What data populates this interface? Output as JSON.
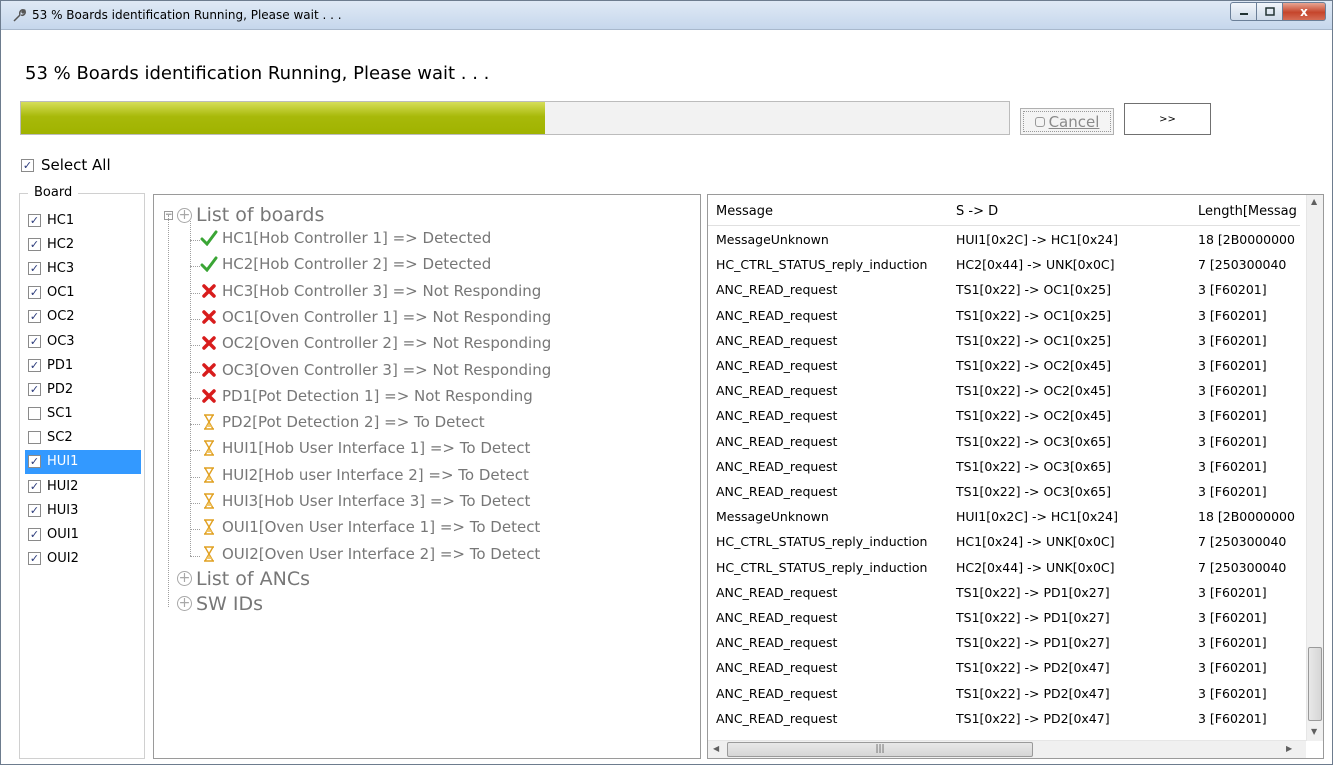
{
  "window": {
    "title": "53 % Boards identification Running, Please wait . . .",
    "close_label": "x"
  },
  "status": {
    "heading": "53 % Boards identification Running, Please wait . . .",
    "progress_percent": 53
  },
  "buttons": {
    "cancel": "Cancel",
    "more": ">>"
  },
  "select_all": {
    "label": "Select All",
    "checked": true
  },
  "board_group": {
    "legend": "Board",
    "items": [
      {
        "label": "HC1",
        "checked": true
      },
      {
        "label": "HC2",
        "checked": true
      },
      {
        "label": "HC3",
        "checked": true
      },
      {
        "label": "OC1",
        "checked": true
      },
      {
        "label": "OC2",
        "checked": true
      },
      {
        "label": "OC3",
        "checked": true
      },
      {
        "label": "PD1",
        "checked": true
      },
      {
        "label": "PD2",
        "checked": true
      },
      {
        "label": "SC1",
        "checked": false
      },
      {
        "label": "SC2",
        "checked": false
      },
      {
        "label": "HUI1",
        "checked": true,
        "selected": true
      },
      {
        "label": "HUI2",
        "checked": true
      },
      {
        "label": "HUI3",
        "checked": true
      },
      {
        "label": "OUI1",
        "checked": true
      },
      {
        "label": "OUI2",
        "checked": true
      }
    ]
  },
  "tree": {
    "roots": [
      {
        "label": "List of boards",
        "expanded": true,
        "children": [
          {
            "text": "HC1[Hob Controller 1] => Detected",
            "icon": "check-icon"
          },
          {
            "text": "HC2[Hob Controller 2] => Detected",
            "icon": "check-icon"
          },
          {
            "text": "HC3[Hob Controller 3] => Not Responding",
            "icon": "cross-icon"
          },
          {
            "text": "OC1[Oven Controller 1] => Not Responding",
            "icon": "cross-icon"
          },
          {
            "text": "OC2[Oven Controller 2] => Not Responding",
            "icon": "cross-icon"
          },
          {
            "text": "OC3[Oven Controller 3] => Not Responding",
            "icon": "cross-icon"
          },
          {
            "text": "PD1[Pot Detection 1] => Not Responding",
            "icon": "cross-icon"
          },
          {
            "text": "PD2[Pot Detection 2] => To Detect",
            "icon": "hourglass-icon"
          },
          {
            "text": "HUI1[Hob User Interface 1] => To Detect",
            "icon": "hourglass-icon"
          },
          {
            "text": "HUI2[Hob user Interface 2] => To Detect",
            "icon": "hourglass-icon"
          },
          {
            "text": "HUI3[Hob User Interface 3] => To Detect",
            "icon": "hourglass-icon"
          },
          {
            "text": "OUI1[Oven User Interface 1] => To Detect",
            "icon": "hourglass-icon"
          },
          {
            "text": "OUI2[Oven User Interface 2] => To Detect",
            "icon": "hourglass-icon"
          }
        ]
      },
      {
        "label": "List of ANCs",
        "expanded": false,
        "children": []
      },
      {
        "label": "SW IDs",
        "expanded": false,
        "children": []
      }
    ]
  },
  "messages": {
    "columns": [
      "Message",
      "S  -> D",
      "Length[Messag"
    ],
    "rows": [
      [
        "MessageUnknown",
        "HUI1[0x2C] -> HC1[0x24]",
        "18 [2B0000000"
      ],
      [
        "HC_CTRL_STATUS_reply_induction",
        "HC2[0x44] -> UNK[0x0C]",
        "7 [250300040"
      ],
      [
        "ANC_READ_request",
        "TS1[0x22] -> OC1[0x25]",
        "3 [F60201]"
      ],
      [
        "ANC_READ_request",
        "TS1[0x22] -> OC1[0x25]",
        "3 [F60201]"
      ],
      [
        "ANC_READ_request",
        "TS1[0x22] -> OC1[0x25]",
        "3 [F60201]"
      ],
      [
        "ANC_READ_request",
        "TS1[0x22] -> OC2[0x45]",
        "3 [F60201]"
      ],
      [
        "ANC_READ_request",
        "TS1[0x22] -> OC2[0x45]",
        "3 [F60201]"
      ],
      [
        "ANC_READ_request",
        "TS1[0x22] -> OC2[0x45]",
        "3 [F60201]"
      ],
      [
        "ANC_READ_request",
        "TS1[0x22] -> OC3[0x65]",
        "3 [F60201]"
      ],
      [
        "ANC_READ_request",
        "TS1[0x22] -> OC3[0x65]",
        "3 [F60201]"
      ],
      [
        "ANC_READ_request",
        "TS1[0x22] -> OC3[0x65]",
        "3 [F60201]"
      ],
      [
        "MessageUnknown",
        "HUI1[0x2C] -> HC1[0x24]",
        "18 [2B0000000"
      ],
      [
        "HC_CTRL_STATUS_reply_induction",
        "HC1[0x24] -> UNK[0x0C]",
        "7 [250300040"
      ],
      [
        "HC_CTRL_STATUS_reply_induction",
        "HC2[0x44] -> UNK[0x0C]",
        "7 [250300040"
      ],
      [
        "ANC_READ_request",
        "TS1[0x22] -> PD1[0x27]",
        "3 [F60201]"
      ],
      [
        "ANC_READ_request",
        "TS1[0x22] -> PD1[0x27]",
        "3 [F60201]"
      ],
      [
        "ANC_READ_request",
        "TS1[0x22] -> PD1[0x27]",
        "3 [F60201]"
      ],
      [
        "ANC_READ_request",
        "TS1[0x22] -> PD2[0x47]",
        "3 [F60201]"
      ],
      [
        "ANC_READ_request",
        "TS1[0x22] -> PD2[0x47]",
        "3 [F60201]"
      ],
      [
        "ANC_READ_request",
        "TS1[0x22] -> PD2[0x47]",
        "3 [F60201]"
      ]
    ]
  },
  "colors": {
    "progress": "#a8b90a",
    "selection": "#3399ff",
    "check": "#3aa535",
    "cross": "#d81c1c",
    "hourglass": "#e0a020"
  }
}
